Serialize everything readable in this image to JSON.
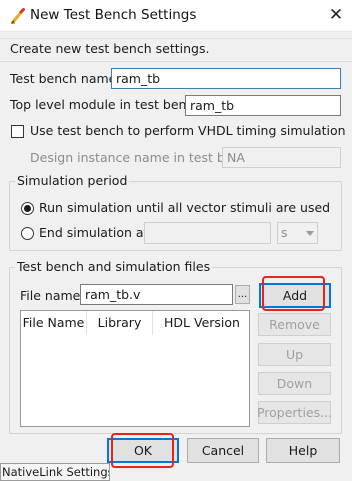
{
  "window": {
    "title": "New Test Bench Settings",
    "close_glyph": "✕",
    "icon": "pencil-icon"
  },
  "intro_text": "Create new test bench settings.",
  "test_bench_name": {
    "label": "Test bench name:",
    "value": "ram_tb"
  },
  "top_level_module": {
    "label": "Top level module in test bench:",
    "value": "ram_tb"
  },
  "vhdl_timing_checkbox": {
    "label": "Use test bench to perform VHDL timing simulation",
    "checked": false
  },
  "design_instance": {
    "label": "Design instance name in test bench:",
    "value": "NA"
  },
  "simulation_period": {
    "title": "Simulation period",
    "option_run_until": {
      "label": "Run simulation until all vector stimuli are used",
      "selected": true
    },
    "option_end_at": {
      "label": "End simulation at:",
      "selected": false,
      "value": "",
      "unit": "s"
    }
  },
  "files_group": {
    "title": "Test bench and simulation files",
    "file_name_label": "File name:",
    "file_name_value": "ram_tb.v",
    "browse_label": "...",
    "columns": [
      "File Name",
      "Library",
      "HDL Version"
    ],
    "buttons": {
      "add": "Add",
      "remove": "Remove",
      "up": "Up",
      "down": "Down",
      "properties": "Properties..."
    }
  },
  "footer": {
    "ok": "OK",
    "cancel": "Cancel",
    "help": "Help"
  },
  "background_tooltip": "NativeLink Settings...",
  "colors": {
    "highlight_red": "#e8221c",
    "focus_blue": "#0078d7"
  }
}
